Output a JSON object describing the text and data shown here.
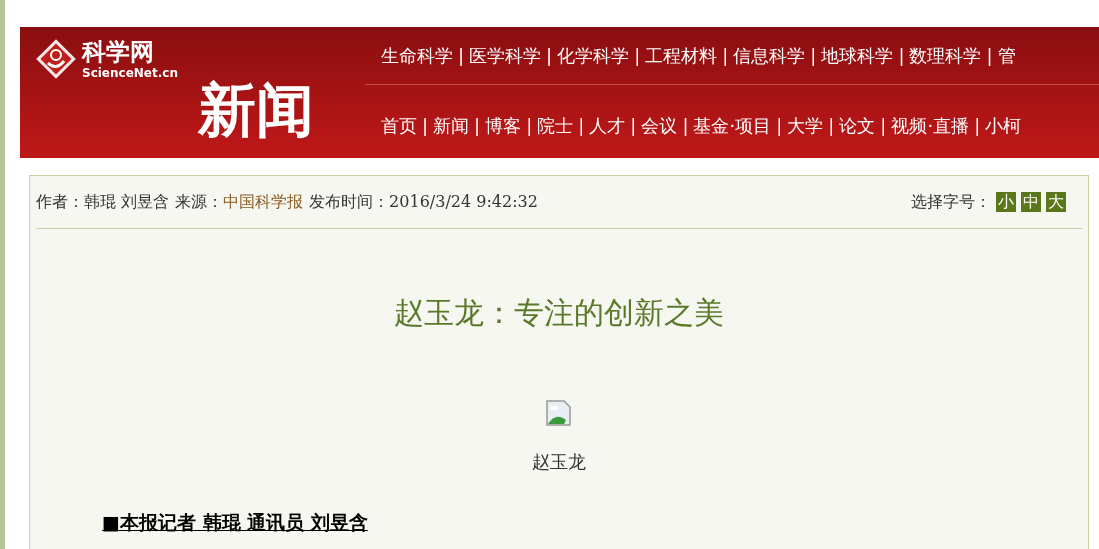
{
  "header": {
    "nav_separator": "|",
    "logo_text": "科学网",
    "logo_domain": "ScienceNet.cn",
    "section_title": "新闻",
    "nav_top": [
      "生命科学",
      "医学科学",
      "化学科学",
      "工程材料",
      "信息科学",
      "地球科学",
      "数理科学",
      "管"
    ],
    "nav_bottom": [
      "首页",
      "新闻",
      "博客",
      "院士",
      "人才",
      "会议",
      "基金·项目",
      "大学",
      "论文",
      "视频·直播",
      "小柯"
    ]
  },
  "article": {
    "meta": {
      "author_label": "作者：",
      "authors": "韩琨 刘昱含",
      "source_label": "来源：",
      "source": "中国科学报",
      "time_label": "发布时间：",
      "time": "2016/3/24 9:42:32"
    },
    "font_size": {
      "label": "选择字号：",
      "options": [
        "小",
        "中",
        "大"
      ]
    },
    "title": "赵玉龙：专注的创新之美",
    "image": {
      "kind": "picture",
      "caption": "赵玉龙"
    },
    "byline": "■本报记者 韩琨 通讯员 刘昱含"
  }
}
